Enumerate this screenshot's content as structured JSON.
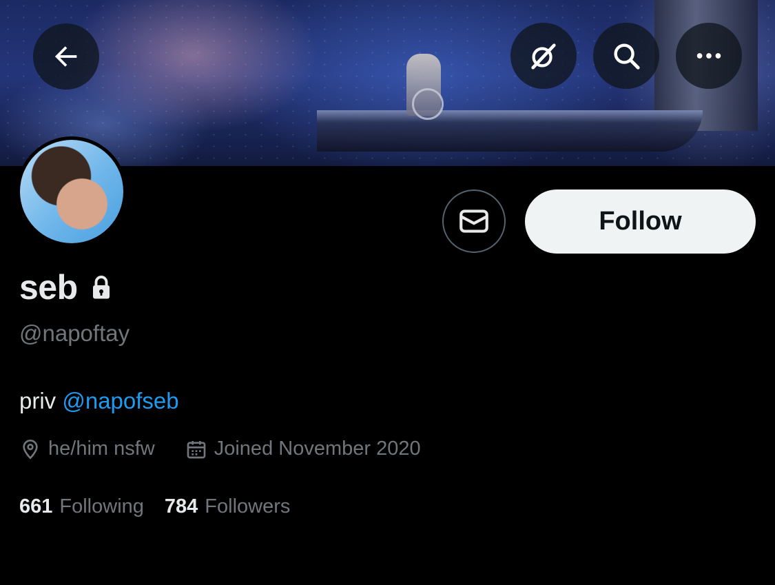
{
  "header": {
    "back_icon": "arrow-left-icon",
    "grok_icon": "grok-icon",
    "search_icon": "search-icon",
    "more_icon": "more-dots-icon",
    "banner_colors": [
      "#1c2a63",
      "#24357a",
      "#121a3e"
    ]
  },
  "actions": {
    "message_icon": "envelope-icon",
    "follow_label": "Follow"
  },
  "profile": {
    "display_name": "seb",
    "protected_icon": "lock-icon",
    "handle": "@napoftay",
    "bio_text": "priv ",
    "bio_mention": "@napofseb",
    "location": "he/him nsfw",
    "location_icon": "location-pin-icon",
    "joined": "Joined November 2020",
    "joined_icon": "calendar-icon"
  },
  "stats": {
    "following_count": "661",
    "following_label": "Following",
    "followers_count": "784",
    "followers_label": "Followers"
  },
  "colors": {
    "background": "#000000",
    "primary_text": "#e7e9ea",
    "secondary_text": "#71767b",
    "link": "#1d9bf0",
    "follow_button_bg": "#eff3f4"
  }
}
